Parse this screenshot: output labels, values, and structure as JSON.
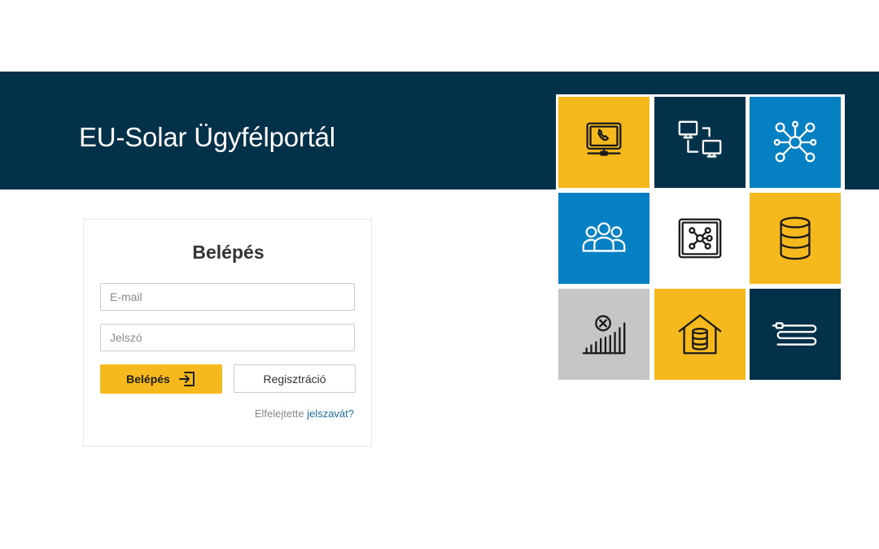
{
  "header": {
    "title": "EU-Solar Ügyfélportál"
  },
  "login": {
    "title": "Belépés",
    "email_placeholder": "E-mail",
    "password_placeholder": "Jelszó",
    "login_button_label": "Belépés",
    "register_button_label": "Regisztráció",
    "forgot_prefix": "Elfelejtette",
    "forgot_link": "jelszavát?"
  },
  "tiles": [
    {
      "icon": "phone-monitor-icon",
      "color": "#f5b91e"
    },
    {
      "icon": "network-computers-icon",
      "color": "#04314a"
    },
    {
      "icon": "hub-nodes-icon",
      "color": "#0580c3"
    },
    {
      "icon": "users-group-icon",
      "color": "#0580c3"
    },
    {
      "icon": "network-box-icon",
      "color": "#ffffff"
    },
    {
      "icon": "database-icon",
      "color": "#f5b91e"
    },
    {
      "icon": "signal-error-icon",
      "color": "#c6c6c6"
    },
    {
      "icon": "house-database-icon",
      "color": "#f5b91e"
    },
    {
      "icon": "cable-icon",
      "color": "#04314a"
    }
  ],
  "colors": {
    "navy": "#04314a",
    "yellow": "#f5b91e",
    "blue": "#0580c3",
    "gray": "#c6c6c6",
    "link": "#1f6fa3"
  }
}
